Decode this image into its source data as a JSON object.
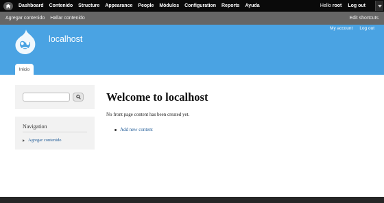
{
  "toolbar": {
    "home_icon": "home-icon",
    "menu": [
      "Dashboard",
      "Contenido",
      "Structure",
      "Appearance",
      "People",
      "Módulos",
      "Configuration",
      "Reports",
      "Ayuda"
    ],
    "hello_prefix": "Hello",
    "username": "root",
    "logout": "Log out",
    "toggle_icon": "chevron-down-icon"
  },
  "shortcuts": {
    "items": [
      "Agregar contenido",
      "Hallar contenido"
    ],
    "edit": "Edit shortcuts"
  },
  "header": {
    "site_name": "localhost",
    "secondary": [
      "My account",
      "Log out"
    ],
    "tab": "Inicio",
    "color": "#4aa3e3"
  },
  "sidebar": {
    "search_icon": "search-icon",
    "navigation": {
      "title": "Navigation",
      "items": [
        "Agregar contenido"
      ]
    }
  },
  "main": {
    "title": "Welcome to localhost",
    "message": "No front page content has been created yet.",
    "links": [
      "Add new content"
    ]
  }
}
